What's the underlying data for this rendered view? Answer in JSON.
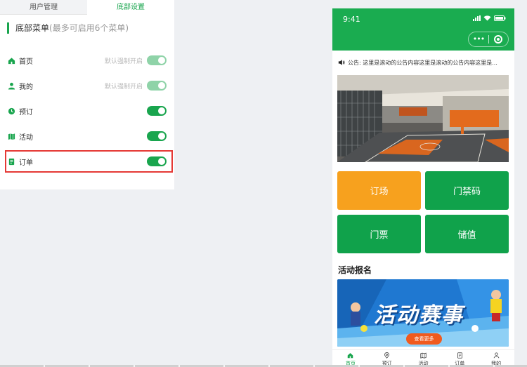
{
  "tabs": [
    {
      "label": "用户管理",
      "active": false
    },
    {
      "label": "底部设置",
      "active": true
    }
  ],
  "section": {
    "title": "底部菜单",
    "hint": "(最多可启用6个菜单)"
  },
  "menu": [
    {
      "label": "首页",
      "icon": "home-icon",
      "note": "默认强制开启",
      "enabled": true,
      "locked": true
    },
    {
      "label": "我的",
      "icon": "user-icon",
      "note": "默认强制开启",
      "enabled": true,
      "locked": true
    },
    {
      "label": "预订",
      "icon": "clock-icon",
      "note": "",
      "enabled": true,
      "locked": false
    },
    {
      "label": "活动",
      "icon": "map-icon",
      "note": "",
      "enabled": true,
      "locked": false
    },
    {
      "label": "订单",
      "icon": "document-icon",
      "note": "",
      "enabled": true,
      "locked": false
    }
  ],
  "phone": {
    "time": "9:41",
    "capsule_dots": "•••",
    "notice": "公告: 这里是滚动的公告内容这里是滚动的公告内容这里是...",
    "buttons": [
      "订场",
      "门禁码",
      "门票",
      "储值"
    ],
    "activity_title": "活动报名",
    "event_banner_title": "活动赛事",
    "more_label": "查看更多",
    "tabbar": [
      {
        "label": "首页",
        "icon": "home-icon",
        "active": true
      },
      {
        "label": "预订",
        "icon": "location-icon",
        "active": false
      },
      {
        "label": "活动",
        "icon": "map-icon",
        "active": false
      },
      {
        "label": "订单",
        "icon": "document-icon",
        "active": false
      },
      {
        "label": "我的",
        "icon": "user-icon",
        "active": false
      }
    ]
  },
  "colors": {
    "accent": "#19a54e",
    "orange": "#f7a11e",
    "highlight": "#e53935",
    "header": "#1aac50"
  }
}
